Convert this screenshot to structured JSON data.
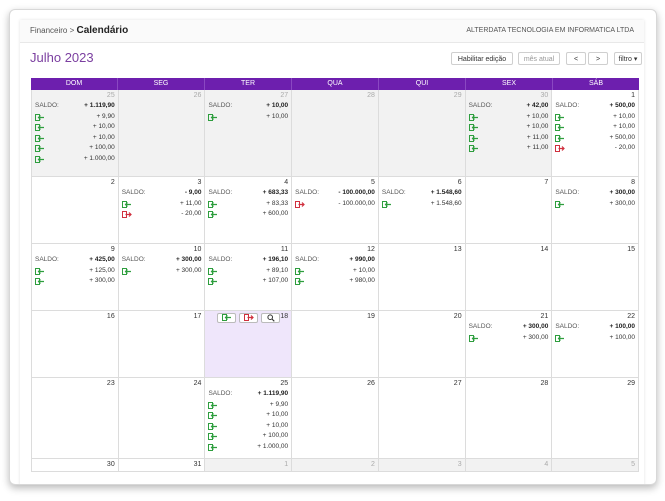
{
  "breadcrumb": {
    "parent": "Financeiro",
    "separator": ">",
    "current": "Calendário"
  },
  "company": "ALTERDATA TECNOLOGIA EM INFORMATICA LTDA",
  "page_title": "Julho 2023",
  "toolbar": {
    "edit_label": "Habilitar edição",
    "current_month_label": "mês atual",
    "prev_label": "<",
    "next_label": ">",
    "filter_label": "filtro ▾"
  },
  "colors": {
    "accent": "#6d1fae",
    "income": "#2e9e3e",
    "expense": "#d0303e"
  },
  "weekdays": [
    "DOM",
    "SEG",
    "TER",
    "QUA",
    "QUI",
    "SEX",
    "SÁB"
  ],
  "saldo_label": "SALDO:",
  "weeks": [
    [
      {
        "day": "25",
        "other": true,
        "saldo": "+ 1.119,90",
        "entries": [
          {
            "t": "in",
            "v": "+ 9,90"
          },
          {
            "t": "in",
            "v": "+ 10,00"
          },
          {
            "t": "in",
            "v": "+ 10,00"
          },
          {
            "t": "in",
            "v": "+ 100,00"
          },
          {
            "t": "in",
            "v": "+ 1.000,00"
          }
        ]
      },
      {
        "day": "26",
        "other": true,
        "saldo": null,
        "entries": []
      },
      {
        "day": "27",
        "other": true,
        "saldo": "+ 10,00",
        "entries": [
          {
            "t": "in",
            "v": "+ 10,00"
          }
        ]
      },
      {
        "day": "28",
        "other": true,
        "saldo": null,
        "entries": []
      },
      {
        "day": "29",
        "other": true,
        "saldo": null,
        "entries": []
      },
      {
        "day": "30",
        "other": true,
        "saldo": "+ 42,00",
        "entries": [
          {
            "t": "in",
            "v": "+ 10,00"
          },
          {
            "t": "in",
            "v": "+ 10,00"
          },
          {
            "t": "in",
            "v": "+ 11,00"
          },
          {
            "t": "in",
            "v": "+ 11,00"
          }
        ]
      },
      {
        "day": "1",
        "other": false,
        "saldo": "+ 500,00",
        "entries": [
          {
            "t": "in",
            "v": "+ 10,00"
          },
          {
            "t": "in",
            "v": "+ 10,00"
          },
          {
            "t": "in",
            "v": "+ 500,00"
          },
          {
            "t": "out",
            "v": "- 20,00"
          }
        ]
      }
    ],
    [
      {
        "day": "2",
        "saldo": null,
        "entries": []
      },
      {
        "day": "3",
        "saldo": "- 9,00",
        "entries": [
          {
            "t": "in",
            "v": "+ 11,00"
          },
          {
            "t": "out",
            "v": "- 20,00"
          }
        ]
      },
      {
        "day": "4",
        "saldo": "+ 683,33",
        "entries": [
          {
            "t": "in",
            "v": "+ 83,33"
          },
          {
            "t": "in",
            "v": "+ 600,00"
          }
        ]
      },
      {
        "day": "5",
        "saldo": "- 100.000,00",
        "entries": [
          {
            "t": "out",
            "v": "- 100.000,00"
          }
        ]
      },
      {
        "day": "6",
        "saldo": "+ 1.548,60",
        "entries": [
          {
            "t": "in",
            "v": "+ 1.548,60"
          }
        ]
      },
      {
        "day": "7",
        "saldo": null,
        "entries": []
      },
      {
        "day": "8",
        "saldo": "+ 300,00",
        "entries": [
          {
            "t": "in",
            "v": "+ 300,00"
          }
        ]
      }
    ],
    [
      {
        "day": "9",
        "saldo": "+ 425,00",
        "entries": [
          {
            "t": "in",
            "v": "+ 125,00"
          },
          {
            "t": "in",
            "v": "+ 300,00"
          }
        ]
      },
      {
        "day": "10",
        "saldo": "+ 300,00",
        "entries": [
          {
            "t": "in",
            "v": "+ 300,00"
          }
        ]
      },
      {
        "day": "11",
        "saldo": "+ 196,10",
        "entries": [
          {
            "t": "in",
            "v": "+ 89,10"
          },
          {
            "t": "in",
            "v": "+ 107,00"
          }
        ]
      },
      {
        "day": "12",
        "saldo": "+ 990,00",
        "entries": [
          {
            "t": "in",
            "v": "+ 10,00"
          },
          {
            "t": "in",
            "v": "+ 980,00"
          }
        ]
      },
      {
        "day": "13",
        "saldo": null,
        "entries": []
      },
      {
        "day": "14",
        "saldo": null,
        "entries": []
      },
      {
        "day": "15",
        "saldo": null,
        "entries": []
      }
    ],
    [
      {
        "day": "16",
        "saldo": null,
        "entries": []
      },
      {
        "day": "17",
        "saldo": null,
        "entries": []
      },
      {
        "day": "18",
        "today": true,
        "saldo": null,
        "entries": []
      },
      {
        "day": "19",
        "saldo": null,
        "entries": []
      },
      {
        "day": "20",
        "saldo": null,
        "entries": []
      },
      {
        "day": "21",
        "saldo": "+ 300,00",
        "entries": [
          {
            "t": "in",
            "v": "+ 300,00"
          }
        ]
      },
      {
        "day": "22",
        "saldo": "+ 100,00",
        "entries": [
          {
            "t": "in",
            "v": "+ 100,00"
          }
        ]
      }
    ],
    [
      {
        "day": "23",
        "saldo": null,
        "entries": []
      },
      {
        "day": "24",
        "saldo": null,
        "entries": []
      },
      {
        "day": "25",
        "saldo": "+ 1.119,90",
        "entries": [
          {
            "t": "in",
            "v": "+ 9,90"
          },
          {
            "t": "in",
            "v": "+ 10,00"
          },
          {
            "t": "in",
            "v": "+ 10,00"
          },
          {
            "t": "in",
            "v": "+ 100,00"
          },
          {
            "t": "in",
            "v": "+ 1.000,00"
          }
        ]
      },
      {
        "day": "26",
        "saldo": null,
        "entries": []
      },
      {
        "day": "27",
        "saldo": null,
        "entries": []
      },
      {
        "day": "28",
        "saldo": null,
        "entries": []
      },
      {
        "day": "29",
        "saldo": null,
        "entries": []
      }
    ],
    [
      {
        "day": "30",
        "saldo": null,
        "entries": []
      },
      {
        "day": "31",
        "saldo": null,
        "entries": []
      },
      {
        "day": "1",
        "other": true,
        "saldo": null,
        "entries": []
      },
      {
        "day": "2",
        "other": true,
        "saldo": null,
        "entries": []
      },
      {
        "day": "3",
        "other": true,
        "saldo": null,
        "entries": []
      },
      {
        "day": "4",
        "other": true,
        "saldo": null,
        "entries": []
      },
      {
        "day": "5",
        "other": true,
        "saldo": null,
        "entries": []
      }
    ]
  ],
  "today_tools": [
    "add-income-icon",
    "add-expense-icon",
    "search-icon"
  ]
}
